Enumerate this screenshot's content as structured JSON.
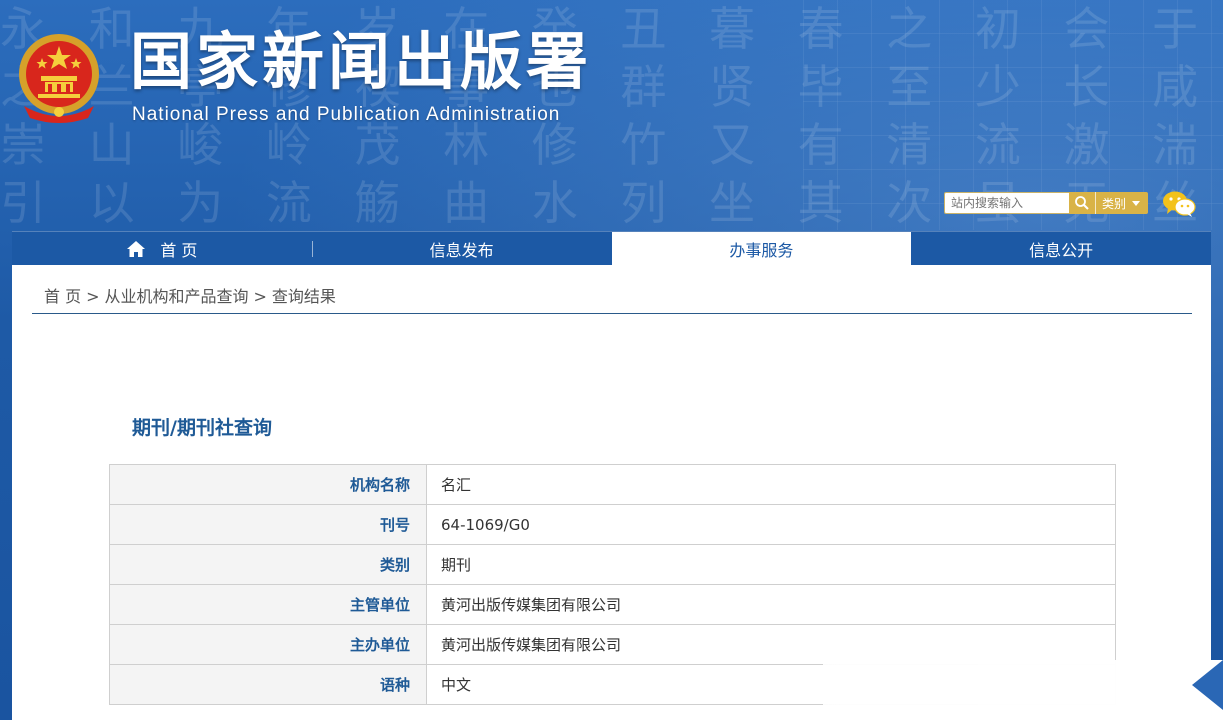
{
  "header": {
    "title": "国家新闻出版署",
    "subtitle": "National  Press and Publication Administration"
  },
  "search": {
    "placeholder": "站内搜索输入",
    "category_label": "类别"
  },
  "nav": {
    "items": [
      {
        "label": "首 页"
      },
      {
        "label": "信息发布"
      },
      {
        "label": "办事服务"
      },
      {
        "label": "信息公开"
      }
    ]
  },
  "breadcrumb": {
    "items": [
      "首 页",
      "从业机构和产品查询",
      "查询结果"
    ],
    "separator": ">"
  },
  "section": {
    "title": "期刊/期刊社查询"
  },
  "table": {
    "rows": [
      {
        "label": "机构名称",
        "value": "名汇"
      },
      {
        "label": "刊号",
        "value": "64-1069/G0"
      },
      {
        "label": "类别",
        "value": "期刊"
      },
      {
        "label": "主管单位",
        "value": "黄河出版传媒集团有限公司"
      },
      {
        "label": "主办单位",
        "value": "黄河出版传媒集团有限公司"
      },
      {
        "label": "语种",
        "value": "中文"
      }
    ]
  },
  "colors": {
    "header_blue": "#1f5fae",
    "accent_gold": "#d9b347",
    "label_blue": "#1f5a96"
  },
  "icons": {
    "emblem": "national-emblem",
    "search": "search-icon",
    "category_dropdown": "caret-down-icon",
    "wechat": "wechat-icon",
    "home": "home-icon"
  }
}
